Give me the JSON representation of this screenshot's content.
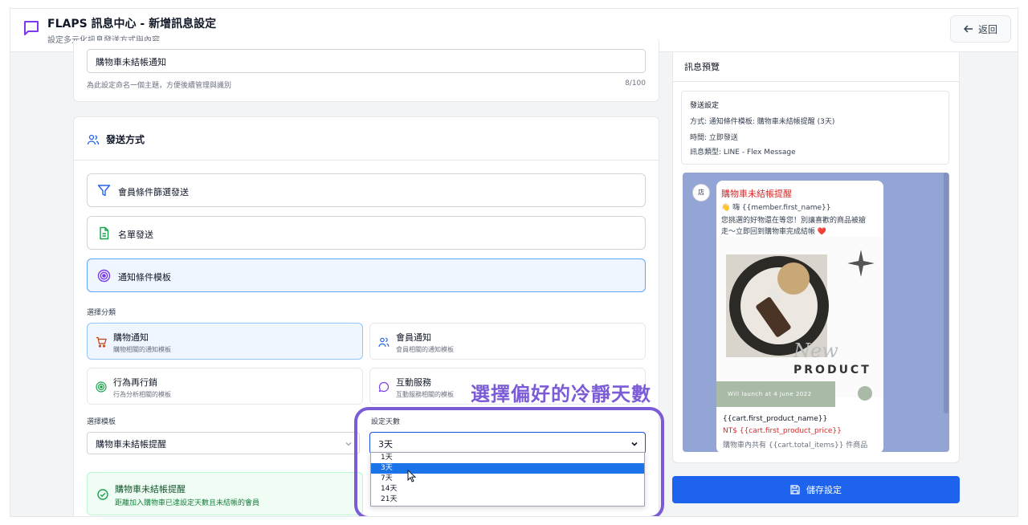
{
  "header": {
    "title": "FLAPS 訊息中心 - 新增訊息設定",
    "subtitle": "設定多元化訊息發送方式與內容",
    "back_label": "返回"
  },
  "name_field": {
    "value": "購物車未結帳通知",
    "hint": "為此設定命名一個主題，方便後續管理與識別",
    "count": "8/100"
  },
  "send_method": {
    "title": "發送方式",
    "options": [
      {
        "label": "會員條件篩選發送",
        "icon": "filter-icon",
        "active": false
      },
      {
        "label": "名單發送",
        "icon": "document-icon",
        "active": false
      },
      {
        "label": "通知條件模板",
        "icon": "target-icon",
        "active": true
      }
    ],
    "category_label": "選擇分類",
    "categories": [
      {
        "label": "購物通知",
        "desc": "購物相關的通知模板",
        "icon": "cart-icon",
        "active": true
      },
      {
        "label": "會員通知",
        "desc": "會員相關的通知模板",
        "icon": "users-icon",
        "active": false
      },
      {
        "label": "行為再行銷",
        "desc": "行為分析相關的模板",
        "icon": "target-icon",
        "active": false
      },
      {
        "label": "互動服務",
        "desc": "互動服務相關的模板",
        "icon": "chat-icon",
        "active": false
      }
    ],
    "template_label": "選擇模板",
    "template_value": "購物車未結帳提醒",
    "days_label": "設定天數",
    "days_value": "3天",
    "days_options": [
      "1天",
      "3天",
      "7天",
      "14天",
      "21天"
    ],
    "days_selected_index": 1,
    "template_info_title": "購物車未結帳提醒",
    "template_info_desc": "距離加入購物車已達設定天數且未結帳的會員"
  },
  "callout": "選擇偏好的冷靜天數",
  "preview": {
    "title": "訊息預覽",
    "settings_title": "發送設定",
    "method": "方式: 通知條件模板: 購物車未結帳提醒 (3天)",
    "time": "時間: 立即發送",
    "type": "訊息類型: LINE - Flex Message",
    "avatar": "店",
    "bubble_title": "購物車未結帳提醒",
    "greeting": "👋 嗨 {{member.first_name}}",
    "body_line1": "您挑選的好物還在等您！別讓喜歡的商品被搶",
    "body_line2": "走～立即回到購物車完成結帳 ❤️",
    "image_text_new": "New",
    "image_text_product": "PRODUCT",
    "image_text_launch": "Will launch at 4 June 2022",
    "product_name": "{{cart.first_product_name}}",
    "product_price": "NT$ {{cart.first_product_price}}",
    "total_items": "購物車內共有 {{cart.total_items}} 件商品"
  },
  "save_label": "儲存設定",
  "colors": {
    "accent": "#1d63ed",
    "callout": "#7c5cd6",
    "success_bg": "#f0fdf4",
    "line_bg": "#93a5d4"
  }
}
